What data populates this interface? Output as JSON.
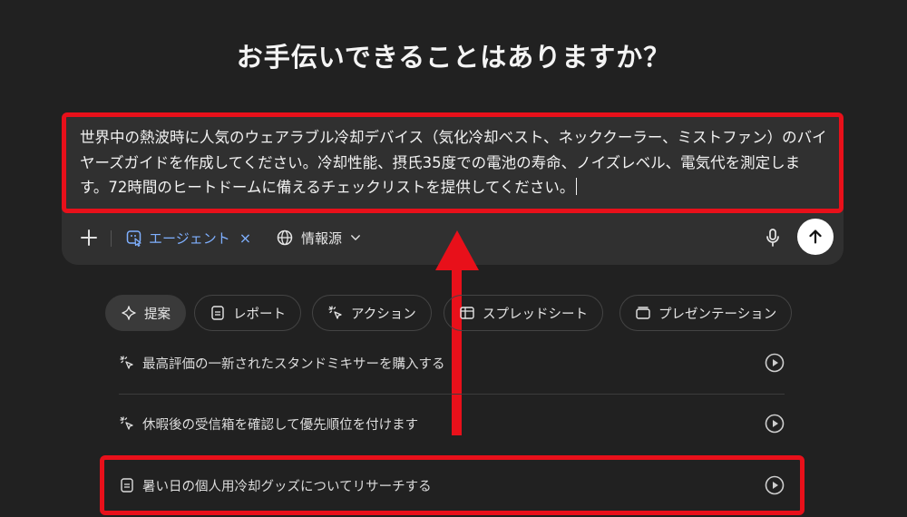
{
  "heading": "お手伝いできることはありますか？",
  "composer": {
    "prompt_text": "世界中の熱波時に人気のウェアラブル冷却デバイス（気化冷却ベスト、ネッククーラー、ミストファン）のバイヤーズガイドを作成してください。冷却性能、摂氏35度での電池の寿命、ノイズレベル、電気代を測定します。72時間のヒートドームに備えるチェックリストを提供してください。",
    "agent_label": "エージェント",
    "agent_close": "×",
    "sources_label": "情報源"
  },
  "chips": [
    {
      "label": "提案",
      "icon": "sparkle-icon",
      "active": true
    },
    {
      "label": "レポート",
      "icon": "document-icon",
      "active": false
    },
    {
      "label": "アクション",
      "icon": "cursor-click-icon",
      "active": false
    },
    {
      "label": "スプレッドシート",
      "icon": "table-icon",
      "active": false
    },
    {
      "label": "プレゼンテーション",
      "icon": "slides-icon",
      "active": false
    }
  ],
  "suggestions": [
    {
      "label": "最高評価の一新されたスタンドミキサーを購入する",
      "icon": "cursor-click-icon"
    },
    {
      "label": "休暇後の受信箱を確認して優先順位を付けます",
      "icon": "cursor-click-icon"
    },
    {
      "label": "暑い日の個人用冷却グッズについてリサーチする",
      "icon": "document-icon"
    }
  ],
  "colors": {
    "background": "#212121",
    "composer": "#303030",
    "accent_blue": "#7fb0ff",
    "annotation_red": "#e8101a"
  }
}
